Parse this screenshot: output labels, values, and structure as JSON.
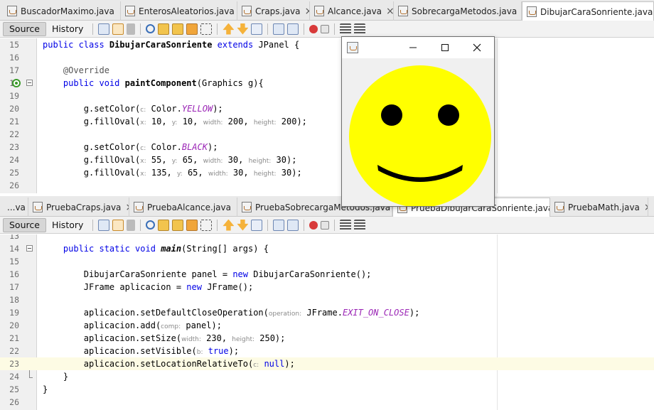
{
  "top_tabs": [
    {
      "label": "BuscadorMaximo.java",
      "active": false
    },
    {
      "label": "EnterosAleatorios.java",
      "active": false
    },
    {
      "label": "Craps.java",
      "active": false
    },
    {
      "label": "Alcance.java",
      "active": false
    },
    {
      "label": "SobrecargaMetodos.java",
      "active": false
    },
    {
      "label": "DibujarCaraSonriente.java",
      "active": true
    }
  ],
  "bottom_tabs": [
    {
      "label": "...va",
      "active": false
    },
    {
      "label": "PruebaCraps.java",
      "active": false
    },
    {
      "label": "PruebaAlcance.java",
      "active": false
    },
    {
      "label": "PruebaSobrecargaMetodos.java",
      "active": false
    },
    {
      "label": "PruebaDibujarCaraSonriente.java",
      "active": true
    },
    {
      "label": "PruebaMath.java",
      "active": false
    }
  ],
  "toolbar": {
    "source_label": "Source",
    "history_label": "History"
  },
  "top_editor": {
    "lines": [
      {
        "n": "15",
        "code": "public class DibujarCaraSonriente extends JPanel {"
      },
      {
        "n": "16",
        "code": ""
      },
      {
        "n": "17",
        "code": "@Override"
      },
      {
        "n": "18",
        "code": "public void paintComponent(Graphics g){"
      },
      {
        "n": "19",
        "code": ""
      },
      {
        "n": "20",
        "code": "g.setColor(c: Color.YELLOW);"
      },
      {
        "n": "21",
        "code": "g.fillOval(x: 10, y: 10, width: 200, height: 200);"
      },
      {
        "n": "22",
        "code": ""
      },
      {
        "n": "23",
        "code": "g.setColor(c: Color.BLACK);"
      },
      {
        "n": "24",
        "code": "g.fillOval(x: 55, y: 65, width: 30, height: 30);"
      },
      {
        "n": "25",
        "code": "g.fillOval(x: 135, y: 65, width: 30, height: 30);"
      },
      {
        "n": "26",
        "code": ""
      }
    ]
  },
  "bottom_editor": {
    "lines": [
      {
        "n": "13",
        "code": ""
      },
      {
        "n": "14",
        "code": "public static void main(String[] args) {"
      },
      {
        "n": "15",
        "code": ""
      },
      {
        "n": "16",
        "code": "DibujarCaraSonriente panel = new DibujarCaraSonriente();"
      },
      {
        "n": "17",
        "code": "JFrame aplicacion = new JFrame();"
      },
      {
        "n": "18",
        "code": ""
      },
      {
        "n": "19",
        "code": "aplicacion.setDefaultCloseOperation(operation: JFrame.EXIT_ON_CLOSE);"
      },
      {
        "n": "20",
        "code": "aplicacion.add(comp: panel);"
      },
      {
        "n": "21",
        "code": "aplicacion.setSize(width: 230, height: 250);"
      },
      {
        "n": "22",
        "code": "aplicacion.setVisible(b: true);"
      },
      {
        "n": "23",
        "code": "aplicacion.setLocationRelativeTo(c: null);"
      },
      {
        "n": "24",
        "code": "}"
      },
      {
        "n": "25",
        "code": "}"
      },
      {
        "n": "26",
        "code": ""
      }
    ]
  },
  "colors": {
    "face": "#ffff00",
    "features": "#000000",
    "keyword": "#0000e6",
    "static_field": "#9b26b6",
    "current_line": "#fdfbe4"
  }
}
